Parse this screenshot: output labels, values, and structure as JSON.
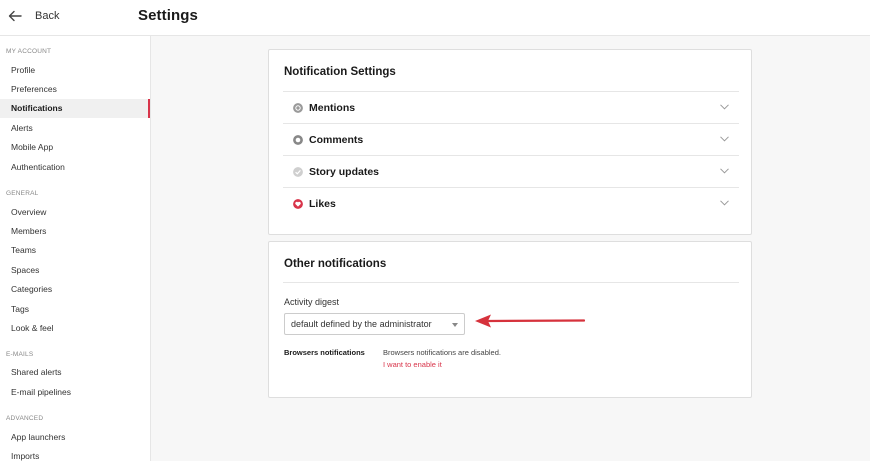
{
  "header": {
    "back_label": "Back",
    "title": "Settings"
  },
  "sidebar": {
    "sections": [
      {
        "heading": "MY ACCOUNT",
        "items": [
          {
            "label": "Profile"
          },
          {
            "label": "Preferences"
          },
          {
            "label": "Notifications",
            "active": true
          },
          {
            "label": "Alerts"
          },
          {
            "label": "Mobile App"
          },
          {
            "label": "Authentication"
          }
        ]
      },
      {
        "heading": "GENERAL",
        "items": [
          {
            "label": "Overview"
          },
          {
            "label": "Members"
          },
          {
            "label": "Teams"
          },
          {
            "label": "Spaces"
          },
          {
            "label": "Categories"
          },
          {
            "label": "Tags"
          },
          {
            "label": "Look & feel"
          }
        ]
      },
      {
        "heading": "E-MAILS",
        "items": [
          {
            "label": "Shared alerts"
          },
          {
            "label": "E-mail pipelines"
          }
        ]
      },
      {
        "heading": "ADVANCED",
        "items": [
          {
            "label": "App launchers"
          },
          {
            "label": "Imports"
          }
        ]
      }
    ]
  },
  "notification_settings": {
    "title": "Notification Settings",
    "rows": [
      {
        "label": "Mentions",
        "icon": "mentions-icon",
        "color": "#9a9a9a"
      },
      {
        "label": "Comments",
        "icon": "comments-icon",
        "color": "#888888"
      },
      {
        "label": "Story updates",
        "icon": "story-updates-icon",
        "color": "#cfcfcf"
      },
      {
        "label": "Likes",
        "icon": "likes-icon",
        "color": "#d8344a"
      }
    ]
  },
  "other_notifications": {
    "title": "Other notifications",
    "digest_label": "Activity digest",
    "digest_value": "default defined by the administrator",
    "browser_label": "Browsers notifications",
    "browser_status": "Browsers notifications are disabled.",
    "browser_link": "I want to enable it"
  },
  "colors": {
    "accent": "#d8344a",
    "annotation_arrow": "#d6323c"
  }
}
